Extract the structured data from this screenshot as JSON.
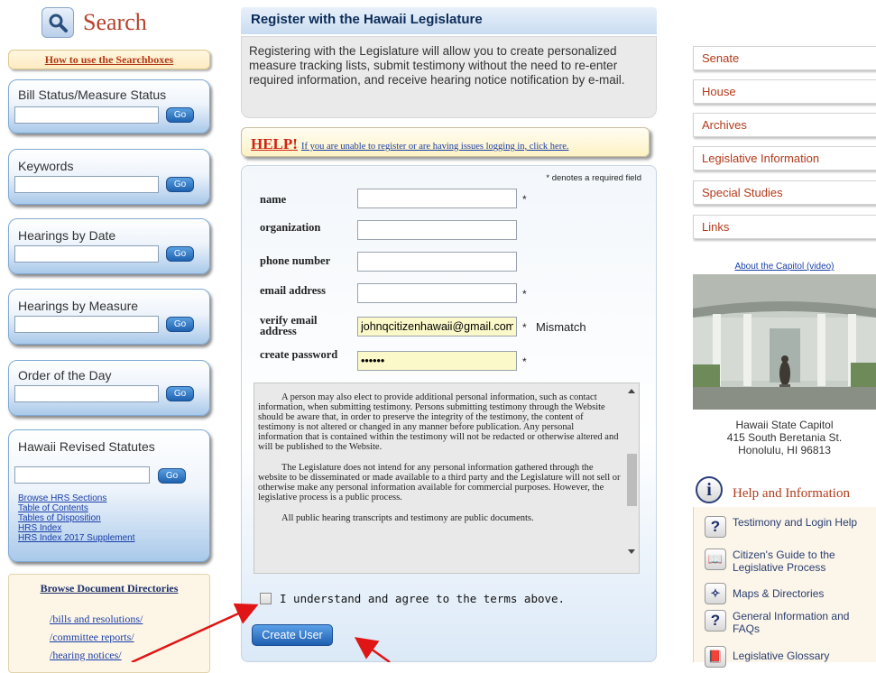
{
  "search": {
    "title": "Search",
    "howto": "How to use the Searchboxes"
  },
  "boxes": [
    {
      "label": "Bill Status/Measure Status",
      "go": "Go"
    },
    {
      "label": "Keywords",
      "go": "Go"
    },
    {
      "label": "Hearings by Date",
      "go": "Go"
    },
    {
      "label": "Hearings by Measure",
      "go": "Go"
    },
    {
      "label": "Order of the Day",
      "go": "Go"
    },
    {
      "label": "Hawaii Revised Statutes",
      "go": "Go"
    }
  ],
  "hrs_links": [
    "Browse HRS Sections",
    "Table of Contents",
    "Tables of Disposition",
    "HRS Index",
    "HRS Index 2017 Supplement"
  ],
  "browse": {
    "title": "Browse Document Directories",
    "links": [
      "/bills and resolutions/",
      "/committee reports/",
      "/hearing notices/"
    ]
  },
  "register": {
    "title": "Register with the Hawaii Legislature",
    "intro": "Registering with the Legislature will allow you to create personalized measure tracking lists, submit testimony without the need to re-enter required information, and receive hearing notice notification by e-mail.",
    "help_label": "HELP!",
    "help_text": "If you are unable to register or are having issues logging in, click here.",
    "required_note": "* denotes a required field",
    "fields": {
      "name": {
        "label": "name",
        "value": ""
      },
      "organization": {
        "label": "organization",
        "value": ""
      },
      "phone": {
        "label": "phone number",
        "value": ""
      },
      "email": {
        "label": "email address",
        "value": ""
      },
      "verify_email": {
        "label": "verify email address",
        "value": "johnqcitizenhawaii@gmail.com",
        "status": "Mismatch"
      },
      "password": {
        "label": "create password",
        "value": "••••••"
      }
    },
    "terms": [
      "A person may also elect to provide additional personal information, such as contact information, when submitting testimony. Persons submitting testimony through the Website should be aware that, in order to preserve the integrity of the testimony, the content of testimony is not altered or changed in any manner before publication. Any personal information that is contained within the testimony will not be redacted or otherwise altered and will be published to the Website.",
      "The Legislature does not intend for any personal information gathered through the website to be disseminated or made available to a third party and the Legislature will not sell or otherwise make any personal information available for commercial purposes.  However, the legislative process is a public process.",
      "All public hearing transcripts and testimony are public documents."
    ],
    "agree_text": "I understand and agree to the terms above.",
    "create_button": "Create User"
  },
  "nav": [
    "Senate",
    "House",
    "Archives",
    "Legislative Information",
    "Special Studies",
    "Links"
  ],
  "capitol": {
    "link": "About the Capitol (video)",
    "name": "Hawaii State Capitol",
    "street": "415 South Beretania St.",
    "city": "Honolulu, HI 96813"
  },
  "help": {
    "title": "Help and Information",
    "items": [
      {
        "icon": "question-icon",
        "label": "Testimony and Login Help"
      },
      {
        "icon": "guide-book-icon",
        "label": "Citizen's Guide to the Legislative Process"
      },
      {
        "icon": "compass-icon",
        "label": "Maps & Directories"
      },
      {
        "icon": "question-icon",
        "label": "General Information and FAQs"
      },
      {
        "icon": "book-icon",
        "label": "Legislative Glossary"
      }
    ]
  },
  "colors": {
    "accent_red": "#b23a1a",
    "arrow_red": "#e01515",
    "button_blue": "#1f5fb0",
    "highlight_yellow": "#fbf9c9"
  }
}
